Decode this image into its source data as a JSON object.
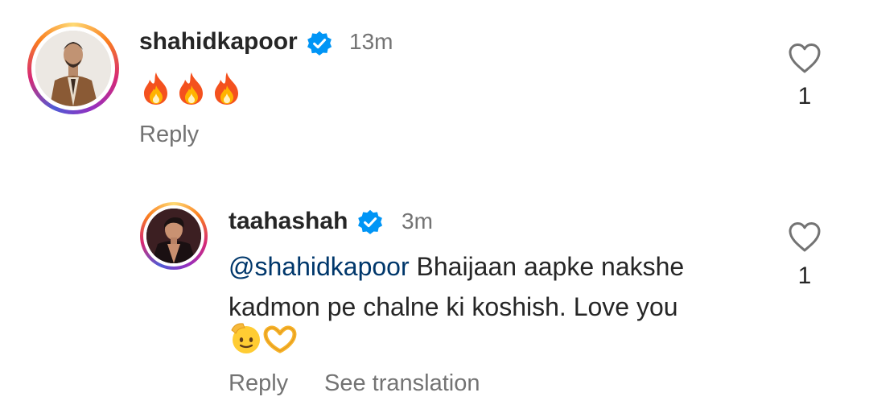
{
  "comments": [
    {
      "username": "shahidkapoor",
      "time": "13m",
      "text": "🔥🔥🔥",
      "likes": "1",
      "actions": [
        "Reply"
      ]
    },
    {
      "username": "taahashah",
      "time": "3m",
      "mention": "@shahidkapoor",
      "text_line1": " Bhaijaan aapke nakshe",
      "text_line2": "kadmon pe chalne ki koshish. Love you",
      "likes": "1",
      "actions": [
        "Reply",
        "See translation"
      ]
    }
  ],
  "icons": {
    "verified": "verified-badge-icon",
    "like": "heart-outline-icon",
    "emoji_salute": "saluting-face-icon",
    "emoji_heart_hands": "heart-hands-icon"
  },
  "colors": {
    "verified": "#0095f6",
    "mention": "#00376b",
    "secondary_text": "#737373"
  }
}
